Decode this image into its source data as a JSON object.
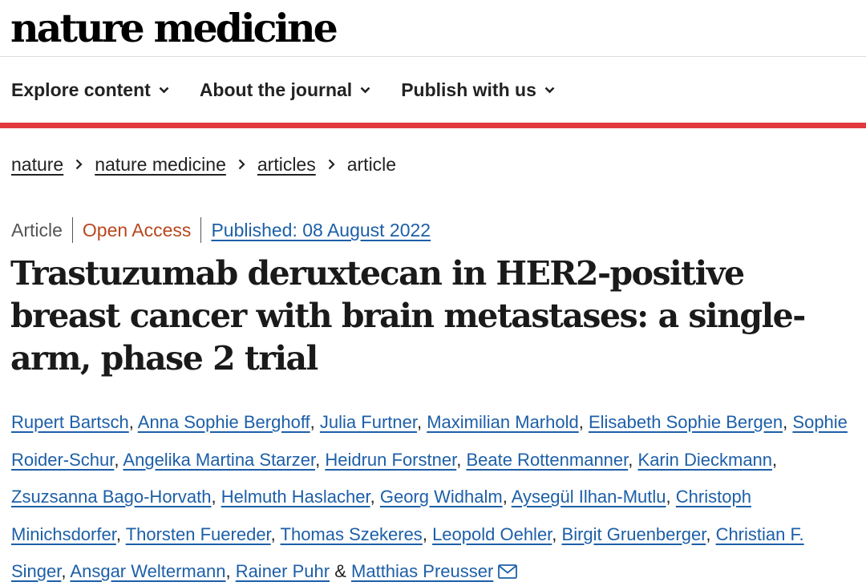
{
  "header": {
    "logo_text": "nature medicine"
  },
  "nav": {
    "items": [
      {
        "label": "Explore content"
      },
      {
        "label": "About the journal"
      },
      {
        "label": "Publish with us"
      }
    ]
  },
  "breadcrumb": {
    "items": [
      "nature",
      "nature medicine",
      "articles"
    ],
    "current": "article"
  },
  "article": {
    "type": "Article",
    "access": "Open Access",
    "published": "Published: 08 August 2022",
    "title": "Trastuzumab deruxtecan in HER2-positive breast cancer with brain metastases: a single-arm, phase 2 trial"
  },
  "authors": [
    "Rupert Bartsch",
    "Anna Sophie Berghoff",
    "Julia Furtner",
    "Maximilian Marhold",
    "Elisabeth Sophie Bergen",
    "Sophie Roider-Schur",
    "Angelika Martina Starzer",
    "Heidrun Forstner",
    "Beate Rottenmanner",
    "Karin Dieckmann",
    "Zsuzsanna Bago-Horvath",
    "Helmuth Haslacher",
    "Georg Widhalm",
    "Aysegül Ilhan-Mutlu",
    "Christoph Minichsdorfer",
    "Thorsten Fuereder",
    "Thomas Szekeres",
    "Leopold Oehler",
    "Birgit Gruenberger",
    "Christian F. Singer",
    "Ansgar Weltermann",
    "Rainer Puhr",
    "Matthias Preusser"
  ],
  "author_separators": {
    "comma": ",",
    "ampersand": "&"
  },
  "icons": {
    "nav_chevron": "chevron-down-icon",
    "breadcrumb_separator": "chevron-right-icon",
    "corresponding_author": "mail-icon"
  },
  "colors": {
    "accent_red": "#e0393e",
    "link_blue": "#1d5fa8",
    "open_access": "#b9471e",
    "text": "#222222"
  }
}
